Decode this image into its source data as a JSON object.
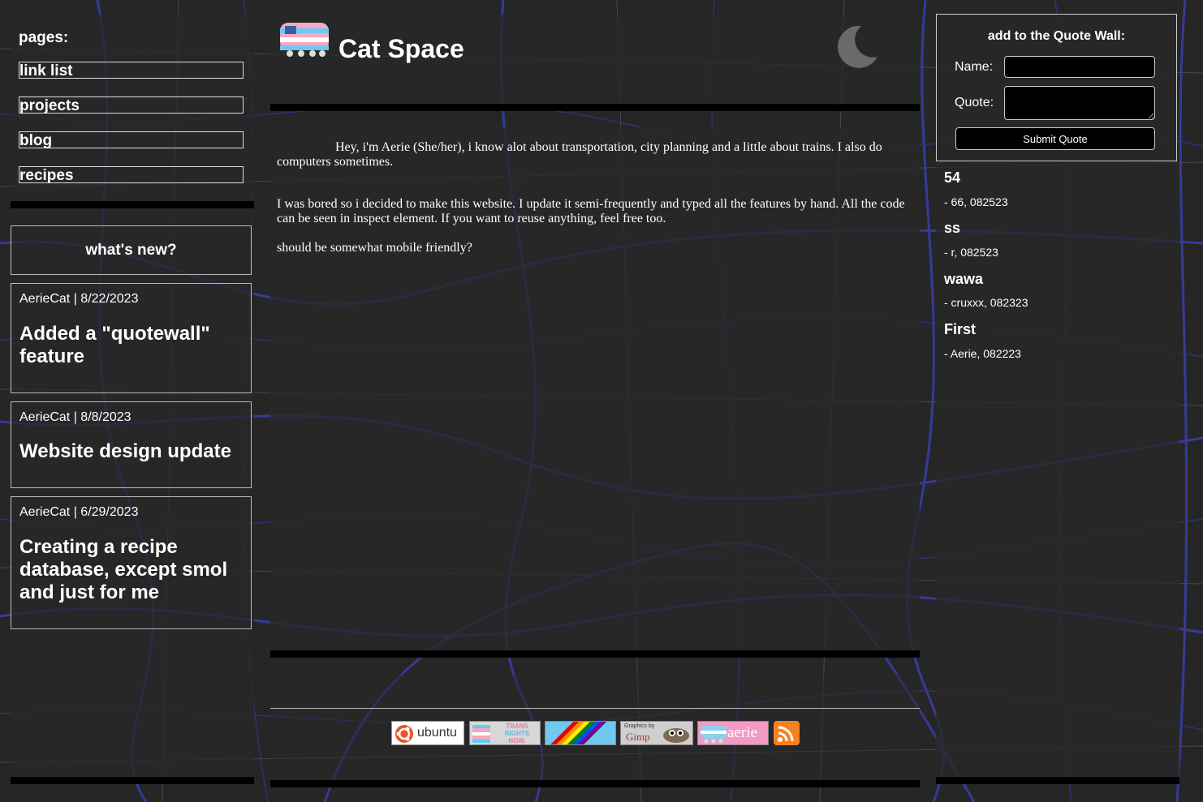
{
  "site": {
    "title": "Cat Space"
  },
  "nav": {
    "heading": "pages:",
    "links": [
      {
        "label": "link list"
      },
      {
        "label": "projects"
      },
      {
        "label": "blog"
      },
      {
        "label": "recipes"
      }
    ]
  },
  "whats_new": {
    "heading": "what's new?",
    "posts": [
      {
        "meta": "AerieCat | 8/22/2023",
        "title": "Added a \"quotewall\" feature"
      },
      {
        "meta": "AerieCat | 8/8/2023",
        "title": "Website design update"
      },
      {
        "meta": "AerieCat | 6/29/2023",
        "title": "Creating a recipe database, except smol and just for me"
      }
    ]
  },
  "main": {
    "p1": "Hey, i'm Aerie (She/her), i know alot about transportation, city planning and a little about trains. I also do computers sometimes.",
    "p2": "I was bored so i decided to make this website. I update it semi-frequently and typed all the features by hand. All the code can be seen in inspect element. If you want to reuse anything, feel free too.",
    "p3": "should be somewhat mobile friendly?"
  },
  "quote_form": {
    "title": "add to the Quote Wall:",
    "name_label": "Name:",
    "quote_label": "Quote:",
    "submit_label": "Submit Quote"
  },
  "quotes": [
    {
      "text": "54",
      "attribution": "- 66, 082523"
    },
    {
      "text": "ss",
      "attribution": "- r, 082523"
    },
    {
      "text": "wawa",
      "attribution": "- cruxxx, 082323"
    },
    {
      "text": "First",
      "attribution": "- Aerie, 082223"
    }
  ],
  "badges": {
    "ubuntu": "ubuntu",
    "trans_rights_top": "TRANS",
    "trans_rights_mid": "RIGHTS",
    "trans_rights_bot": "NOW.",
    "gimp_top": "Graphics by",
    "gimp": "Gimp",
    "aerie": "aerie"
  },
  "colors": {
    "panel": "#282828",
    "bar": "#000000",
    "text": "#ffffff",
    "map_roads": "#3a3fd0"
  }
}
